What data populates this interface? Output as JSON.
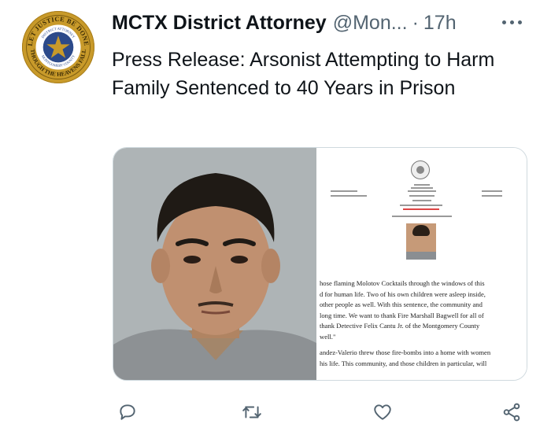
{
  "tweet": {
    "display_name": "MCTX District Attorney",
    "handle": "@Mon...",
    "separator": "·",
    "time": "17h",
    "text": "Press Release: Arsonist Attempting to Harm Family Sentenced to 40 Years in Prison"
  },
  "avatar": {
    "seal_text_top": "LET JUSTICE BE DONE",
    "seal_text_inner": "DISTRICT ATTORNEY",
    "seal_text_county": "MONTGOMERY COUNTY",
    "seal_text_bottom": "THOUGH THE HEAVENS FALL"
  },
  "media": {
    "document_lines": [
      "hose flaming Molotov Cocktails through the windows of this",
      "d for human life. Two of his own children were asleep inside,",
      "other people as well.  With this sentence, the community and",
      "long time.  We want to thank Fire Marshall Bagwell for all of",
      "thank Detective Felix Cantu Jr. of the Montgomery County",
      "well.\""
    ],
    "document_lines_2": [
      "andez-Valerio threw those fire-bombs into a home with women",
      "his life. This community, and those children in particular, will"
    ]
  },
  "actions": {
    "reply_icon": "reply-icon",
    "retweet_icon": "retweet-icon",
    "like_icon": "heart-icon",
    "share_icon": "share-icon"
  },
  "colors": {
    "text": "#0f1419",
    "secondary": "#536471",
    "seal_gold": "#c89a2a",
    "seal_blue": "#2c4a8a"
  }
}
